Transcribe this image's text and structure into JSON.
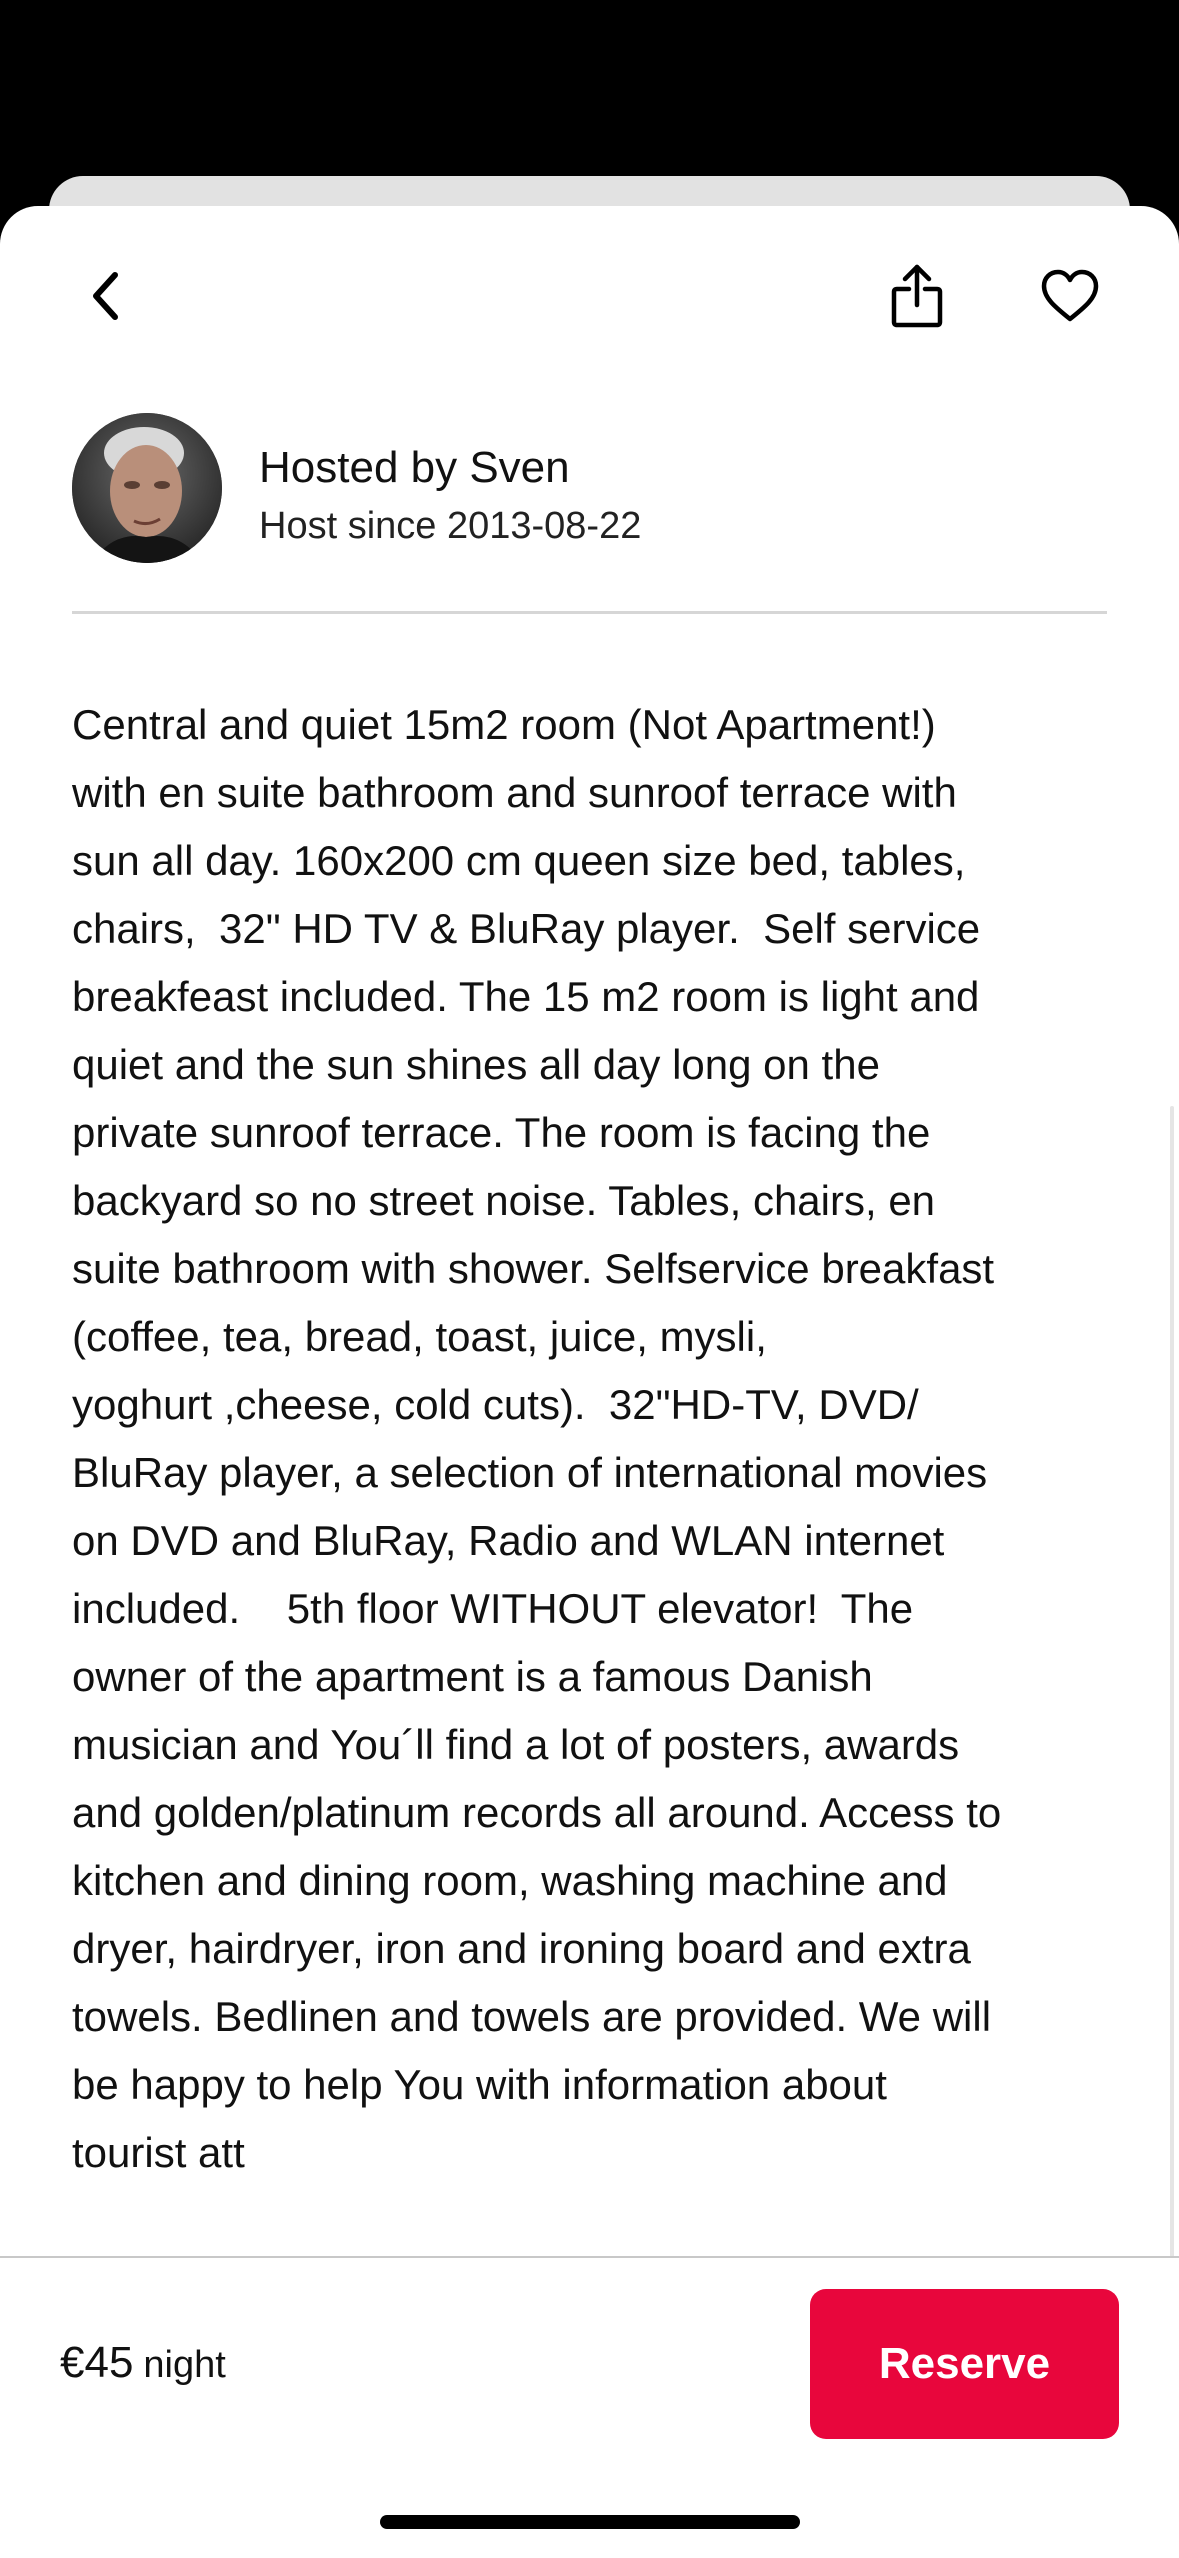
{
  "nav": {
    "back_icon": "chevron-left-icon",
    "share_icon": "share-icon",
    "favorite_icon": "heart-icon"
  },
  "host": {
    "name": "Hosted by Sven",
    "since": "Host since 2013-08-22"
  },
  "listing": {
    "description": "Central and quiet 15m2 room (Not Apartment!)\nwith en suite bathroom and sunroof terrace with\nsun all day. 160x200 cm queen size bed, tables,\nchairs,  32\" HD TV & BluRay player.  Self service\nbreakfeast included. The 15 m2 room is light and\nquiet and the sun shines all day long on the\nprivate sunroof terrace. The room is facing the\nbackyard so no street noise. Tables, chairs, en\nsuite bathroom with shower. Selfservice breakfast\n(coffee, tea, bread, toast, juice, mysli,\nyoghurt ,cheese, cold cuts).  32\"HD-TV, DVD/\nBluRay player, a selection of international movies\non DVD and BluRay, Radio and WLAN internet\nincluded.    5th floor WITHOUT elevator!  The\nowner of the apartment is a famous Danish\nmusician and You´ll find a lot of posters, awards\nand golden/platinum records all around. Access to\nkitchen and dining room, washing machine and\ndryer, hairdryer, iron and ironing board and extra\ntowels. Bedlinen and towels are provided. We will\nbe happy to help You with information about\ntourist att"
  },
  "footer": {
    "price": "€45",
    "unit": "night",
    "reserve_label": "Reserve"
  },
  "colors": {
    "accent": "#e8063c",
    "text": "#111111",
    "divider": "#d6d6d6"
  }
}
